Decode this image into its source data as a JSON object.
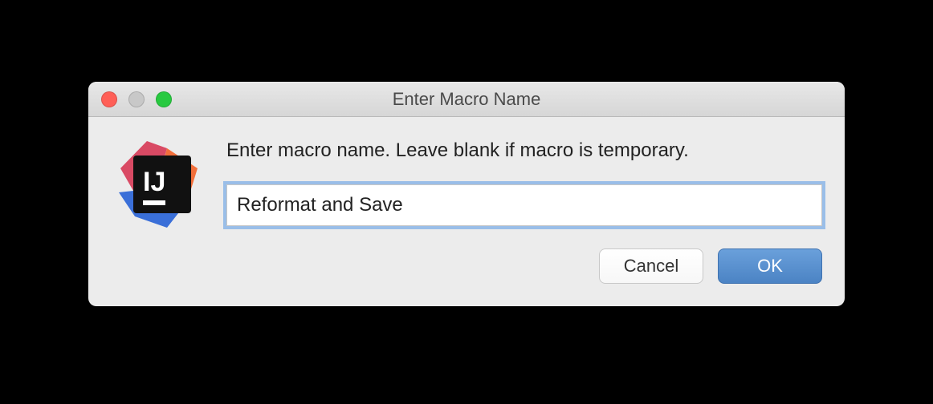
{
  "dialog": {
    "title": "Enter Macro Name",
    "prompt": "Enter macro name. Leave blank if macro is temporary.",
    "input_value": "Reformat and Save",
    "buttons": {
      "cancel": "Cancel",
      "ok": "OK"
    }
  },
  "icon": {
    "name": "intellij-idea-icon",
    "text": "IJ"
  }
}
